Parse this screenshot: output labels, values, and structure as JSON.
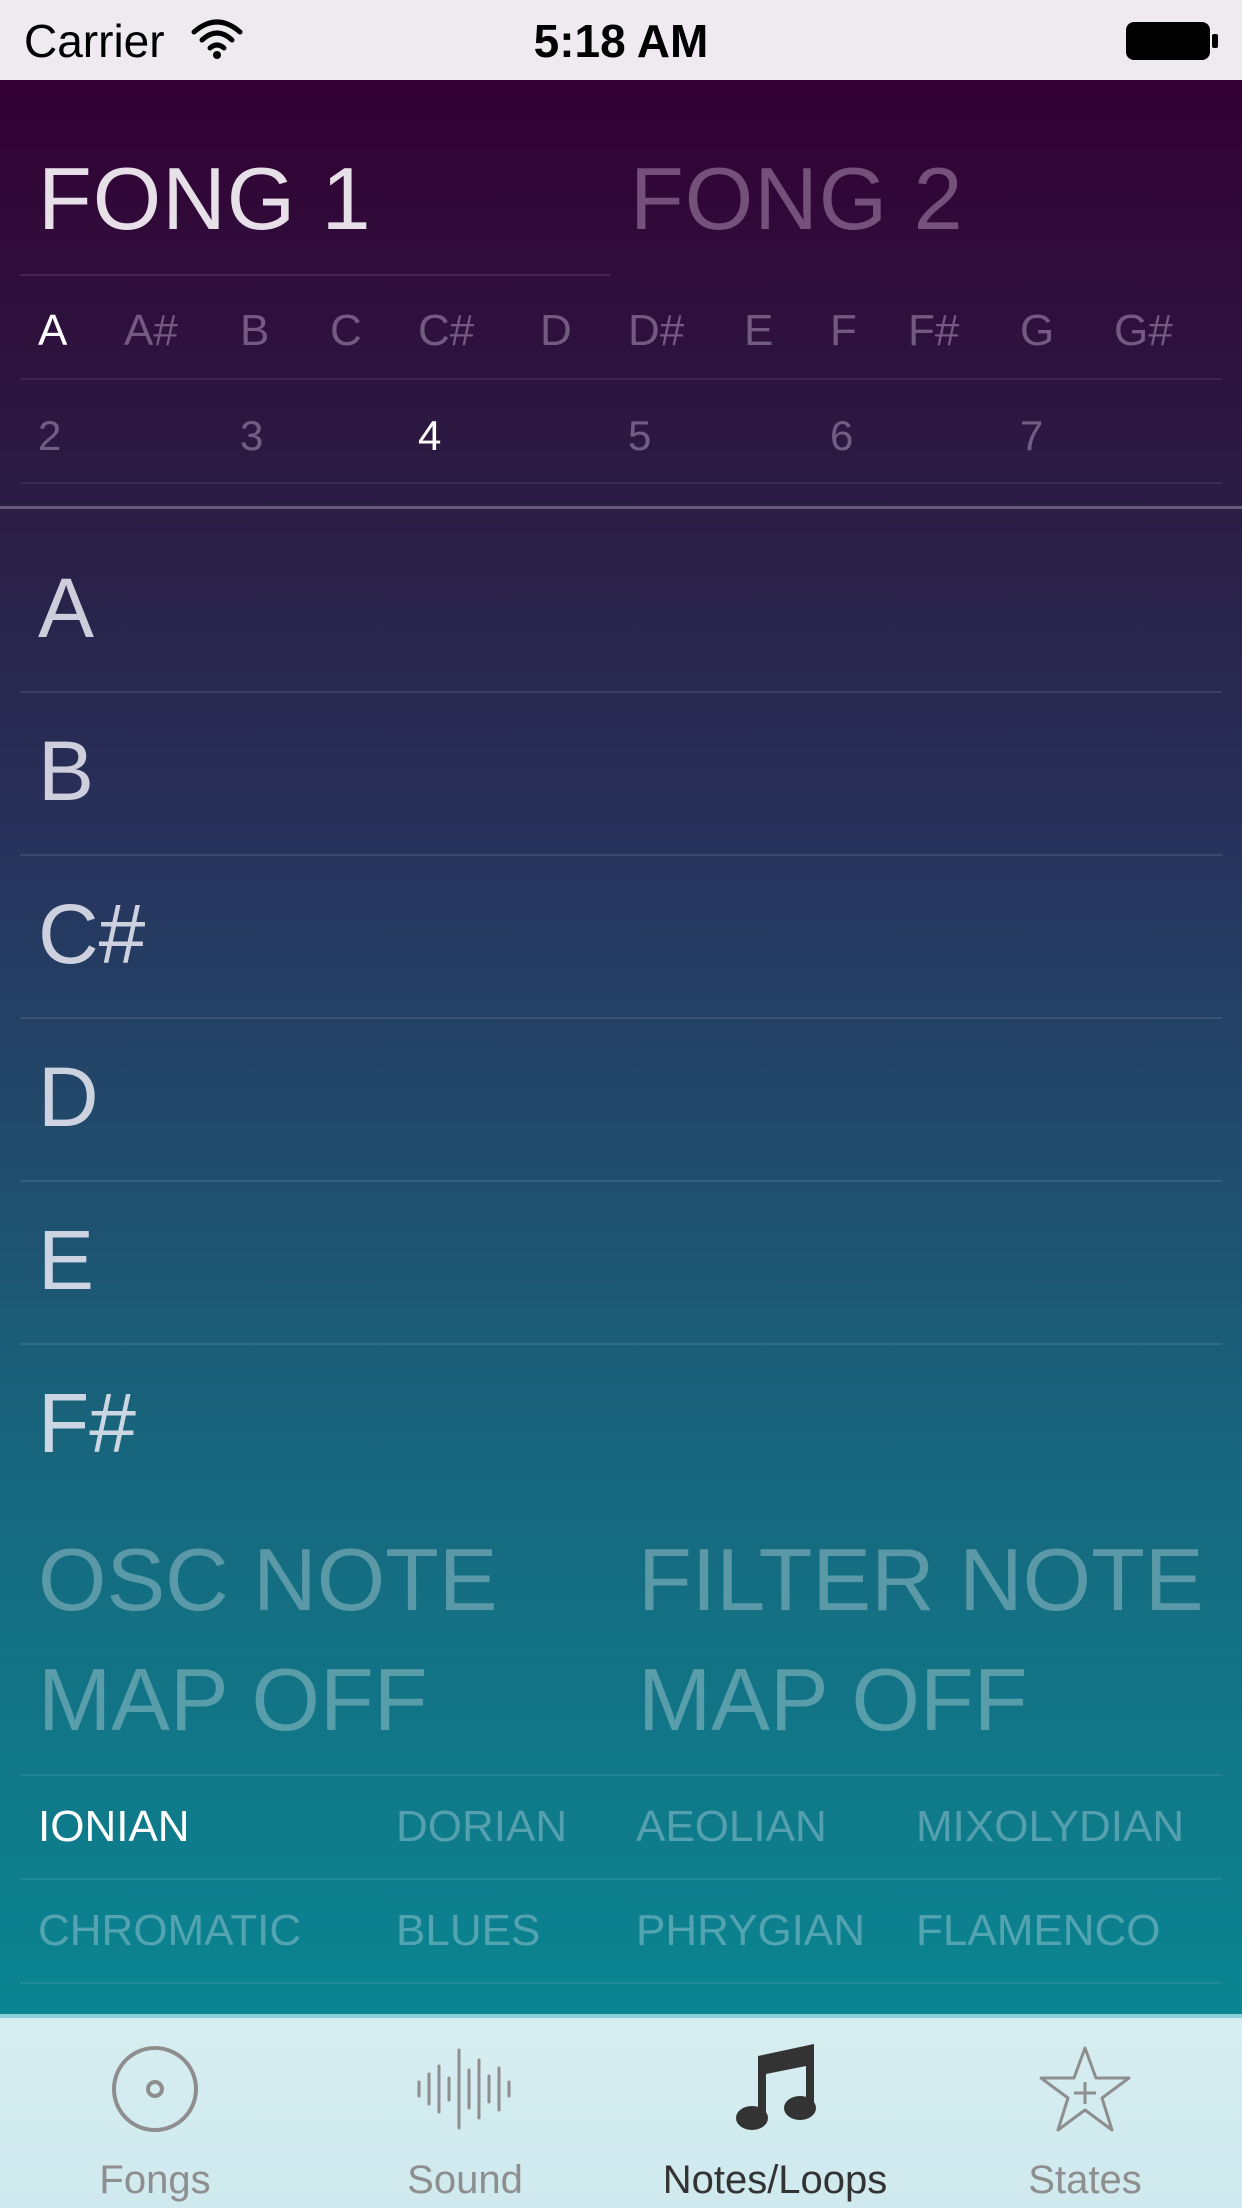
{
  "status_bar": {
    "carrier": "Carrier",
    "time": "5:18 AM"
  },
  "fong_tabs": [
    {
      "label": "FONG 1",
      "active": true
    },
    {
      "label": "FONG 2",
      "active": false
    }
  ],
  "root_notes": {
    "items": [
      "A",
      "A#",
      "B",
      "C",
      "C#",
      "D",
      "D#",
      "E",
      "F",
      "F#",
      "G",
      "G#"
    ],
    "selected": "A"
  },
  "octaves": {
    "items": [
      "2",
      "3",
      "4",
      "5",
      "6",
      "7"
    ],
    "selected": "4"
  },
  "scale_notes": [
    "A",
    "B",
    "C#",
    "D",
    "E",
    "F#"
  ],
  "map": {
    "osc": {
      "line1": "OSC NOTE",
      "line2": "MAP OFF"
    },
    "filter": {
      "line1": "FILTER NOTE",
      "line2": "MAP OFF"
    }
  },
  "modes": {
    "row1": [
      "IONIAN",
      "DORIAN",
      "AEOLIAN",
      "MIXOLYDIAN"
    ],
    "row2": [
      "CHROMATIC",
      "BLUES",
      "PHRYGIAN",
      "FLAMENCO"
    ],
    "selected": "IONIAN"
  },
  "tab_bar": {
    "items": [
      {
        "label": "Fongs",
        "icon": "disc-icon"
      },
      {
        "label": "Sound",
        "icon": "waveform-icon"
      },
      {
        "label": "Notes/Loops",
        "icon": "music-note-icon"
      },
      {
        "label": "States",
        "icon": "star-plus-icon"
      }
    ],
    "active": "Notes/Loops"
  }
}
